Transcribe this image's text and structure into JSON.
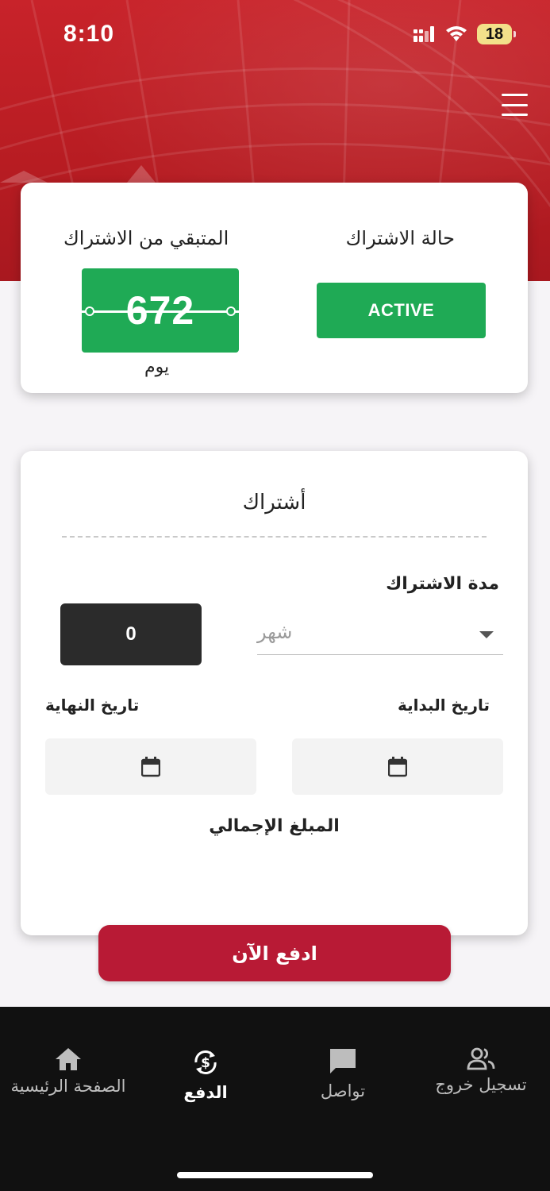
{
  "status_bar": {
    "time": "8:10",
    "battery": "18"
  },
  "colors": {
    "brand_red": "#b81a35",
    "hero_red": "#c8232a",
    "active_green": "#1faa55",
    "nav_bg": "#111111"
  },
  "subscription_status": {
    "status_label": "حالة الاشتراك",
    "status_value": "ACTIVE",
    "remaining_label": "المتبقي من الاشتراك",
    "remaining_days": "672",
    "remaining_unit": "يوم"
  },
  "subscription_form": {
    "title": "أشتراك",
    "duration_label": "مدة الاشتراك",
    "duration_unit": "شهر",
    "duration_count": "0",
    "start_date_label": "تاريخ البداية",
    "end_date_label": "تاريخ النهاية",
    "total_label": "المبلغ الإجمالي"
  },
  "pay_button": "ادفع الآن",
  "bottom_nav": {
    "items": [
      {
        "label": "الصفحة الرئيسية",
        "icon": "home-icon"
      },
      {
        "label": "الدفع",
        "icon": "currency-exchange-icon",
        "active": true
      },
      {
        "label": "تواصل",
        "icon": "chat-icon"
      },
      {
        "label": "تسجيل خروج",
        "icon": "people-icon"
      }
    ]
  }
}
